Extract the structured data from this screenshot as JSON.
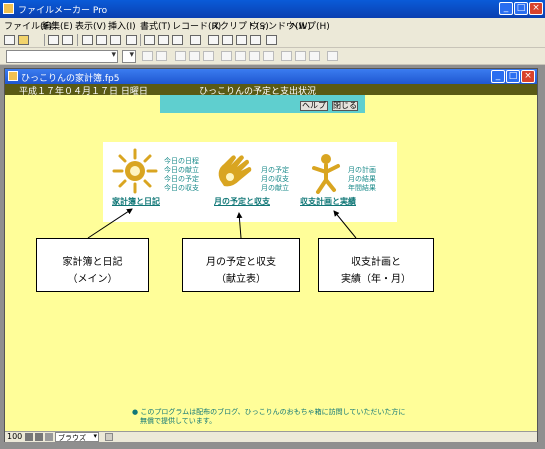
{
  "window": {
    "title": "ファイルメーカー Pro"
  },
  "menubar": [
    "ファイル(F)",
    "編集(E)",
    "表示(V)",
    "挿入(I)",
    "書式(T)",
    "レコード(R)",
    "スクリプト(S)",
    "ウィンドウ(W)",
    "ヘルプ(H)"
  ],
  "inner_window": {
    "title": "ひっこりんの家計簿.fp5"
  },
  "header": {
    "date": "平成１７年０４月１７日 日曜日",
    "app_title": "ひっこりんの予定と支出状況"
  },
  "buttons": {
    "help": "ヘルプ",
    "close": "閉じる"
  },
  "menu_items": [
    {
      "caption": "家計簿と日記",
      "links": [
        "今日の日程",
        "今日の献立",
        "今日の予定",
        "今日の収支"
      ]
    },
    {
      "caption": "月の予定と収支",
      "links": [
        "月の予定",
        "月の収支",
        "月の献立"
      ]
    },
    {
      "caption": "収支計画と実績",
      "links": [
        "月の計画",
        "月の結果",
        "年間結果"
      ]
    }
  ],
  "callouts": [
    {
      "line1": "家計簿と日記",
      "line2": "（メイン）"
    },
    {
      "line1": "月の予定と収支",
      "line2": "（献立表）"
    },
    {
      "line1": "収支計画と",
      "line2": "実績（年・月）"
    }
  ],
  "footer_note": {
    "line1": "● このプログラムは配布のブログ、ひっこりんのおもちゃ箱に訪問していただいた方に",
    "line2": "無償で提供しています。"
  },
  "statusbar": {
    "zoom": "100",
    "mode": "ブラウズ"
  },
  "colors": {
    "background": "#fffe99",
    "header_band": "#5a5a14",
    "accent_cyan": "#5fcfcf",
    "icon_gold": "#d9a521",
    "link_teal": "#1a8a8a"
  },
  "icons": [
    "sun-icon",
    "hand-icon",
    "figure-icon"
  ]
}
